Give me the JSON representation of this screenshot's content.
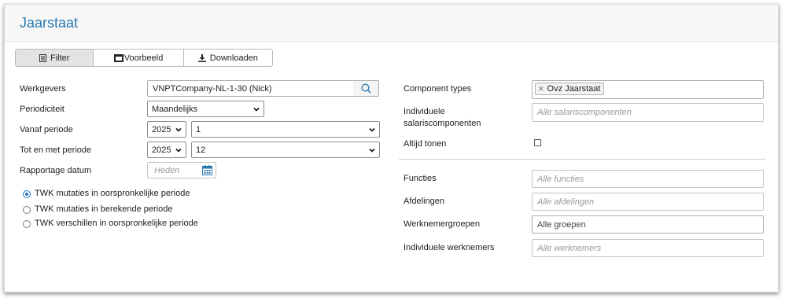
{
  "header": {
    "title": "Jaarstaat"
  },
  "tabs": [
    {
      "label": "Filter",
      "icon": "filter-list-icon"
    },
    {
      "label": "Voorbeeld",
      "icon": "preview-window-icon"
    },
    {
      "label": "Downloaden",
      "icon": "download-icon"
    }
  ],
  "left": {
    "werkgevers": {
      "label": "Werkgevers",
      "value": "VNPTCompany-NL-1-30 (Nick)"
    },
    "periodiciteit": {
      "label": "Periodiciteit",
      "value": "Maandelijks"
    },
    "vanaf": {
      "label": "Vanaf periode",
      "year": "2025",
      "period": "1"
    },
    "tot": {
      "label": "Tot en met periode",
      "year": "2025",
      "period": "12"
    },
    "rapportage": {
      "label": "Rapportage datum",
      "placeholder": "Heden"
    },
    "radios": [
      {
        "label": "TWK mutaties in oorspronkelijke periode",
        "checked": true
      },
      {
        "label": "TWK mutaties in berekende periode",
        "checked": false
      },
      {
        "label": "TWK verschillen in oorspronkelijke periode",
        "checked": false
      }
    ]
  },
  "right": {
    "component_types": {
      "label": "Component types",
      "tag": "Ovz Jaarstaat"
    },
    "individuele_salaris": {
      "label_line1": "Individuele",
      "label_line2": "salariscomponenten",
      "placeholder": "Alle salariscomponenten"
    },
    "altijd_tonen": {
      "label": "Altijd tonen",
      "checked": false
    },
    "functies": {
      "label": "Functies",
      "placeholder": "Alle functies"
    },
    "afdelingen": {
      "label": "Afdelingen",
      "placeholder": "Alle afdelingen"
    },
    "werknemergroepen": {
      "label": "Werknemergroepen",
      "value": "Alle groepen"
    },
    "individuele_werknemers": {
      "label": "Individuele werknemers",
      "placeholder": "Alle werknemers"
    }
  },
  "colors": {
    "title": "#2a7ab0",
    "accent": "#1a73c8",
    "calendar": "#2a7ab0"
  }
}
